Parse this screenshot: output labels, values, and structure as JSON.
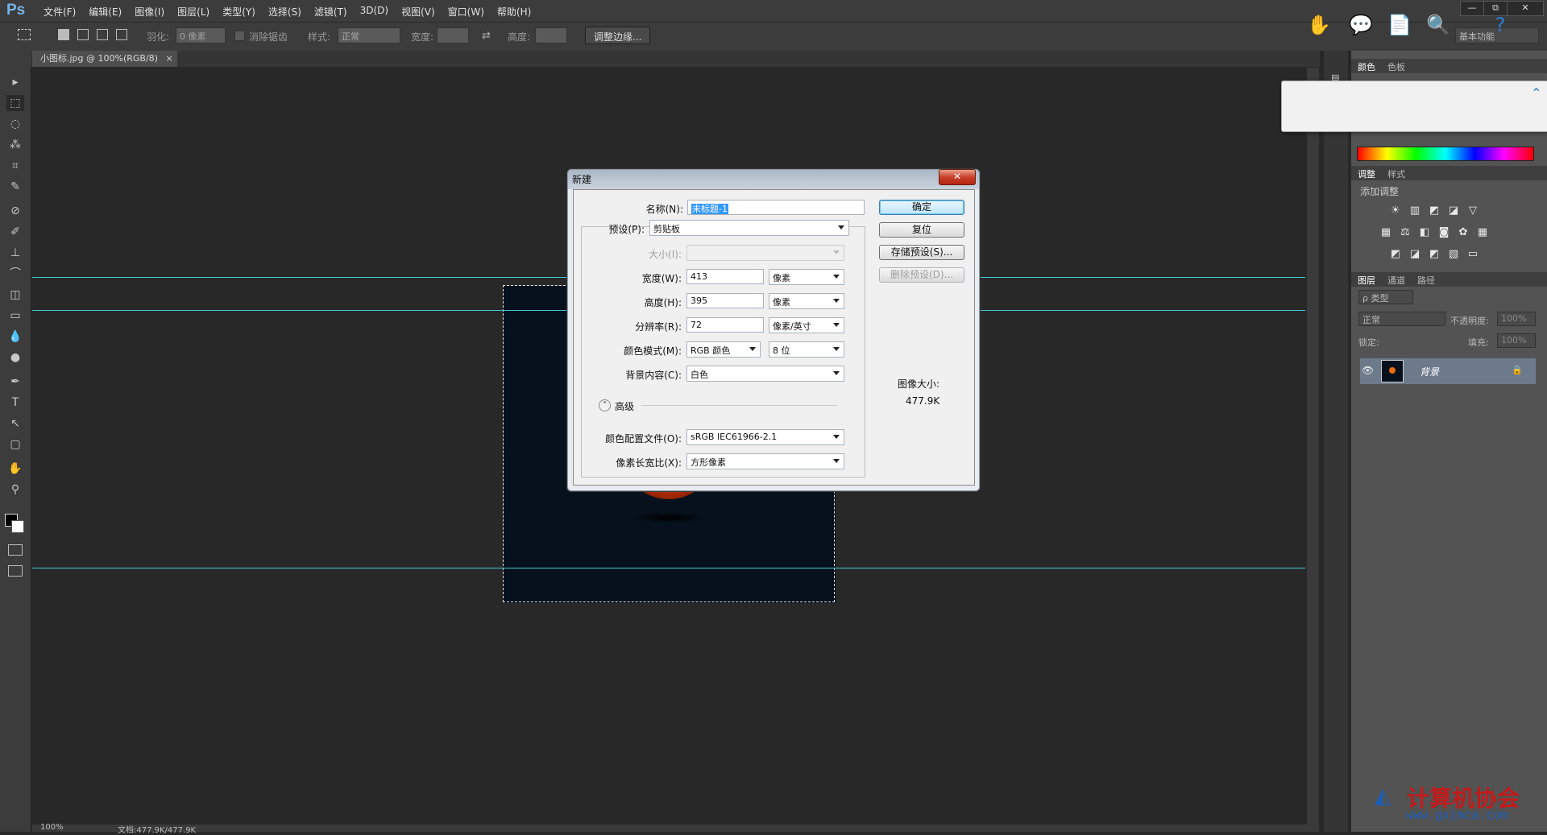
{
  "app": {
    "logo": "Ps",
    "menu": [
      "文件(F)",
      "编辑(E)",
      "图像(I)",
      "图层(L)",
      "类型(Y)",
      "选择(S)",
      "滤镜(T)",
      "3D(D)",
      "视图(V)",
      "窗口(W)",
      "帮助(H)"
    ],
    "window_buttons": [
      "—",
      "⧉",
      "✕"
    ]
  },
  "options_bar": {
    "feather_label": "羽化:",
    "feather_value": "0 像素",
    "antialias_label": "消除锯齿",
    "style_label": "样式:",
    "style_value": "正常",
    "width_label": "宽度:",
    "height_label": "高度:",
    "refine_edge_button": "调整边缘...",
    "workspace": "基本功能"
  },
  "document": {
    "tab_title": "小图标.jpg @ 100%(RGB/8)",
    "tab_close": "×",
    "status_zoom": "100%",
    "status_doc": "文档:477.9K/477.9K"
  },
  "tools": [
    "▸",
    "⬚",
    "◌",
    "⁂",
    "⌗",
    "✎",
    "⊘",
    "✐",
    "⊥",
    "⌒",
    "◫",
    "▭",
    "💧",
    "●",
    "✒",
    "T",
    "↖",
    "▢",
    "✋",
    "⚲"
  ],
  "panels": {
    "color_tabs": [
      "颜色",
      "色板"
    ],
    "adjust_tabs": [
      "调整",
      "样式"
    ],
    "adjust_title": "添加调整",
    "layers_tabs": [
      "图层",
      "通道",
      "路径"
    ],
    "kind_filter": "ρ 类型",
    "blend_mode": "正常",
    "opacity_label": "不透明度:",
    "opacity_value": "100%",
    "lock_label": "锁定:",
    "fill_label": "填充:",
    "fill_value": "100%",
    "layer_name": "背景"
  },
  "dialog": {
    "title": "新建",
    "close": "✕",
    "name_label": "名称(N):",
    "name_value": "未标题-1",
    "preset_label": "预设(P):",
    "preset_value": "剪贴板",
    "size_label": "大小(I):",
    "width_label": "宽度(W):",
    "width_value": "413",
    "width_unit": "像素",
    "height_label": "高度(H):",
    "height_value": "395",
    "height_unit": "像素",
    "resolution_label": "分辨率(R):",
    "resolution_value": "72",
    "resolution_unit": "像素/英寸",
    "color_mode_label": "颜色模式(M):",
    "color_mode_value": "RGB 颜色",
    "bit_depth_value": "8 位",
    "background_label": "背景内容(C):",
    "background_value": "白色",
    "advanced_label": "高级",
    "advanced_toggle": "⌃",
    "color_profile_label": "颜色配置文件(O):",
    "color_profile_value": "sRGB IEC61966-2.1",
    "pixel_aspect_label": "像素长宽比(X):",
    "pixel_aspect_value": "方形像素",
    "ok_button": "确定",
    "reset_button": "复位",
    "save_preset_button": "存储预设(S)...",
    "delete_preset_button": "删除预设(D)...",
    "image_size_label": "图像大小:",
    "image_size_value": "477.9K"
  },
  "watermark": {
    "title": "计算机协会",
    "url": "www.gxjmca.com"
  },
  "colors": {
    "guide": "#3fc9d6",
    "ui_dark": "#282828",
    "ui_panel": "#3c3c3c",
    "accent_blue": "#3399ff"
  }
}
